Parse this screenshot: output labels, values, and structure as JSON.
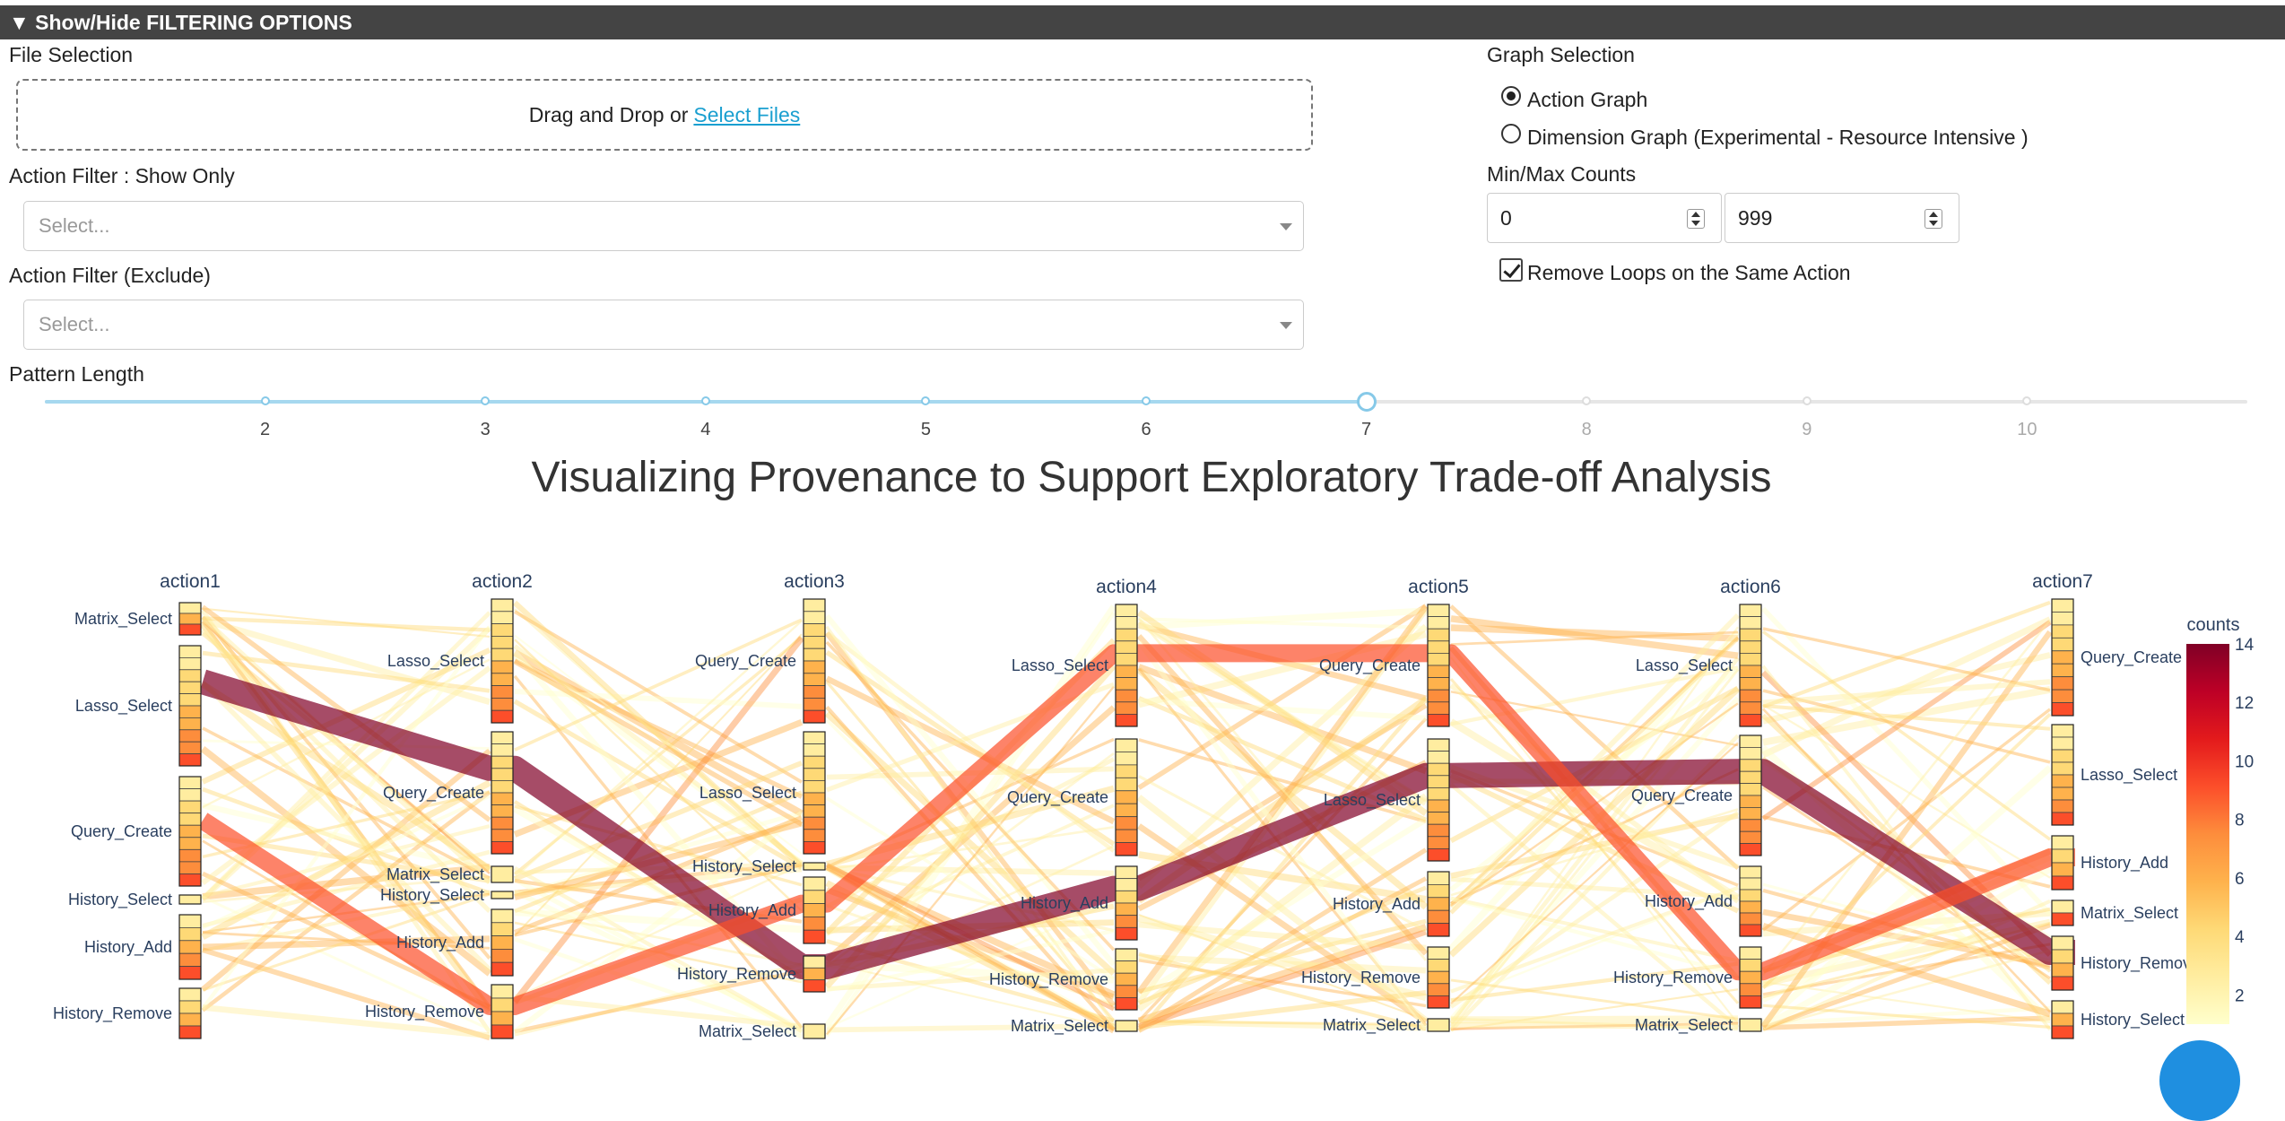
{
  "header": {
    "toggle_label": "▼ Show/Hide FILTERING OPTIONS"
  },
  "file_selection": {
    "label": "File Selection",
    "drop_text": "Drag and Drop or",
    "select_link": "Select Files"
  },
  "action_filter_show": {
    "label": "Action Filter : Show Only",
    "placeholder": "Select..."
  },
  "action_filter_exclude": {
    "label": "Action Filter (Exclude)",
    "placeholder": "Select..."
  },
  "pattern_length": {
    "label": "Pattern Length",
    "marks": [
      "2",
      "3",
      "4",
      "5",
      "6",
      "7",
      "8",
      "9",
      "10"
    ],
    "value": 7,
    "min": 1,
    "max": 11
  },
  "graph_selection": {
    "label": "Graph Selection",
    "options": [
      "Action Graph",
      "Dimension Graph (Experimental - Resource Intensive )"
    ],
    "selected": "Action Graph"
  },
  "counts": {
    "label": "Min/Max Counts",
    "min_value": "0",
    "max_value": "999"
  },
  "remove_loops": {
    "label": "Remove Loops on the Same Action",
    "checked": true
  },
  "chart_title": "Visualizing Provenance to Support Exploratory Trade-off Analysis",
  "chart_data": {
    "type": "parallel-categories",
    "dimensions": [
      {
        "label": "action1",
        "categories": [
          "Matrix_Select",
          "Lasso_Select",
          "Query_Create",
          "History_Select",
          "History_Add",
          "History_Remove"
        ]
      },
      {
        "label": "action2",
        "categories": [
          "Lasso_Select",
          "Query_Create",
          "Matrix_Select",
          "History_Select",
          "History_Add",
          "History_Remove"
        ]
      },
      {
        "label": "action3",
        "categories": [
          "Query_Create",
          "Lasso_Select",
          "History_Select",
          "History_Add",
          "History_Remove",
          "Matrix_Select"
        ]
      },
      {
        "label": "action4",
        "categories": [
          "Lasso_Select",
          "Query_Create",
          "History_Add",
          "History_Remove",
          "Matrix_Select"
        ]
      },
      {
        "label": "action5",
        "categories": [
          "Query_Create",
          "Lasso_Select",
          "History_Add",
          "History_Remove",
          "Matrix_Select"
        ]
      },
      {
        "label": "action6",
        "categories": [
          "Lasso_Select",
          "Query_Create",
          "History_Add",
          "History_Remove",
          "Matrix_Select"
        ]
      },
      {
        "label": "action7",
        "categories": [
          "Query_Create",
          "Lasso_Select",
          "History_Add",
          "Matrix_Select",
          "History_Remove",
          "History_Select"
        ]
      }
    ],
    "highlighted_paths": [
      {
        "count": 14,
        "path": [
          "Lasso_Select",
          "Query_Create",
          "History_Remove",
          "History_Add",
          "Lasso_Select",
          "Query_Create",
          "History_Remove"
        ]
      },
      {
        "count": 9,
        "path": [
          "Query_Create",
          "History_Remove",
          "History_Add",
          "Lasso_Select",
          "Query_Create",
          "History_Remove",
          "History_Add"
        ]
      }
    ],
    "colorscale": {
      "title": "counts",
      "min": 1,
      "max": 14,
      "ticks": [
        2,
        4,
        6,
        8,
        10,
        12,
        14
      ],
      "colors": [
        "#ffffcc",
        "#ffeda0",
        "#fed976",
        "#feb24c",
        "#fd8d3c",
        "#fc4e2a",
        "#e31a1c",
        "#bd0026",
        "#800026"
      ]
    }
  }
}
